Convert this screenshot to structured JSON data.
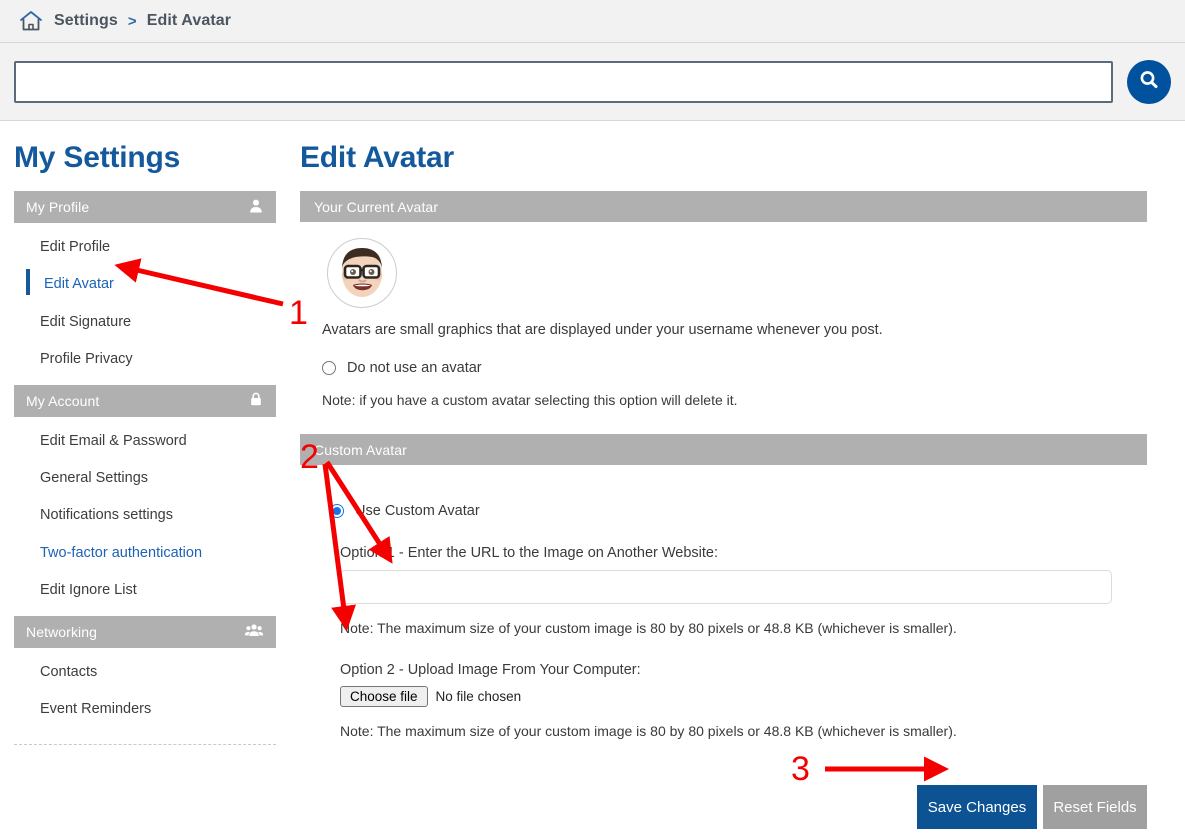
{
  "breadcrumb": {
    "home_icon": "home-icon",
    "items": [
      "Settings",
      "Edit Avatar"
    ],
    "separator": ">"
  },
  "search": {
    "value": "",
    "placeholder": "",
    "button_icon": "search-icon",
    "button_color": "#00529f"
  },
  "sidebar": {
    "title": "My Settings",
    "groups": [
      {
        "header": "My Profile",
        "icon": "user-icon",
        "items": [
          {
            "label": "Edit Profile",
            "state": "default"
          },
          {
            "label": "Edit Avatar",
            "state": "active"
          },
          {
            "label": "Edit Signature",
            "state": "default"
          },
          {
            "label": "Profile Privacy",
            "state": "default"
          }
        ]
      },
      {
        "header": "My Account",
        "icon": "lock-icon",
        "items": [
          {
            "label": "Edit Email & Password",
            "state": "default"
          },
          {
            "label": "General Settings",
            "state": "default"
          },
          {
            "label": "Notifications settings",
            "state": "default"
          },
          {
            "label": "Two-factor authentication",
            "state": "link"
          },
          {
            "label": "Edit Ignore List",
            "state": "default"
          }
        ]
      },
      {
        "header": "Networking",
        "icon": "people-icon",
        "items": [
          {
            "label": "Contacts",
            "state": "default"
          },
          {
            "label": "Event Reminders",
            "state": "default"
          }
        ]
      }
    ]
  },
  "main": {
    "title": "Edit Avatar",
    "current_avatar": {
      "header": "Your Current Avatar",
      "avatar_icon": "memoji-avatar",
      "description": "Avatars are small graphics that are displayed under your username whenever you post.",
      "no_avatar_option": "Do not use an avatar",
      "no_avatar_checked": false,
      "no_avatar_note": "Note: if you have a custom avatar selecting this option will delete it."
    },
    "custom_avatar": {
      "header": "Custom Avatar",
      "use_custom_option": "Use Custom Avatar",
      "use_custom_checked": true,
      "option1_label": "Option 1 - Enter the URL to the Image on Another Website:",
      "option1_value": "",
      "option1_placeholder": "",
      "option1_note": "Note: The maximum size of your custom image is 80 by 80 pixels or 48.8 KB (whichever is smaller).",
      "option2_label": "Option 2 - Upload Image From Your Computer:",
      "choose_file_label": "Choose file",
      "file_status": "No file chosen",
      "option2_note": "Note: The maximum size of your custom image is 80 by 80 pixels or 48.8 KB (whichever is smaller)."
    },
    "buttons": {
      "save_label": "Save Changes",
      "save_color": "#0d5293",
      "reset_label": "Reset Fields",
      "reset_color": "#a0a0a0"
    }
  },
  "annotations": {
    "color": "#f40000",
    "markers": [
      {
        "number": "1",
        "target": "sidebar-item-edit-avatar"
      },
      {
        "number": "2",
        "target": "custom-avatar-inputs"
      },
      {
        "number": "3",
        "target": "save-changes-button"
      }
    ]
  }
}
